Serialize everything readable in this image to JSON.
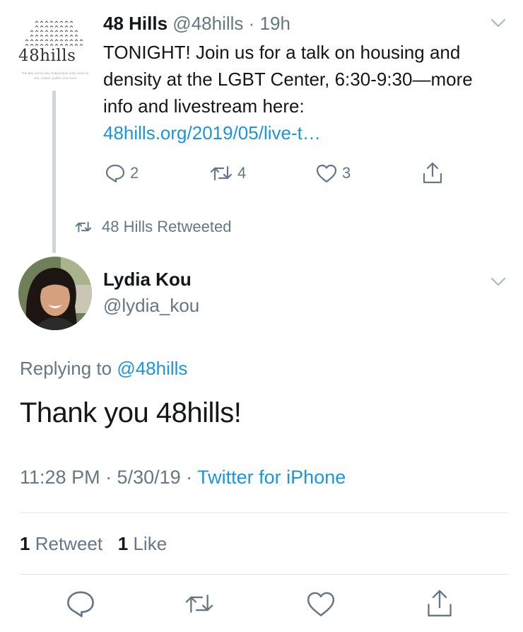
{
  "parent_tweet": {
    "logo_text": "48hills",
    "logo_tagline": "The Bay Area's only independent daily news for arts, culture, politics and more",
    "display_name": "48 Hills",
    "handle": "@48hills",
    "separator": "·",
    "time": "19h",
    "text": "TONIGHT! Join us for a talk on housing and density at the LGBT Center, 6:30-9:30—more info and livestream here: ",
    "link": "48hills.org/2019/05/live-t…",
    "reply_count": "2",
    "retweet_count": "4",
    "like_count": "3"
  },
  "retweeted_by": "48 Hills Retweeted",
  "main_tweet": {
    "display_name": "Lydia Kou",
    "handle": "@lydia_kou",
    "replying_prefix": "Replying to ",
    "replying_to": "@48hills",
    "text": "Thank you 48hills!",
    "timestamp": "11:28 PM · 5/30/19 · ",
    "source": "Twitter for iPhone",
    "retweets_count": "1",
    "retweets_label": "Retweet",
    "likes_count": "1",
    "likes_label": "Like"
  },
  "icons": [
    "reply-icon",
    "retweet-icon",
    "like-icon",
    "share-icon",
    "chevron-down-icon"
  ],
  "colors": {
    "text": "#14171a",
    "secondary": "#657786",
    "link": "#1b95e0",
    "divider": "#e1e8ed"
  }
}
